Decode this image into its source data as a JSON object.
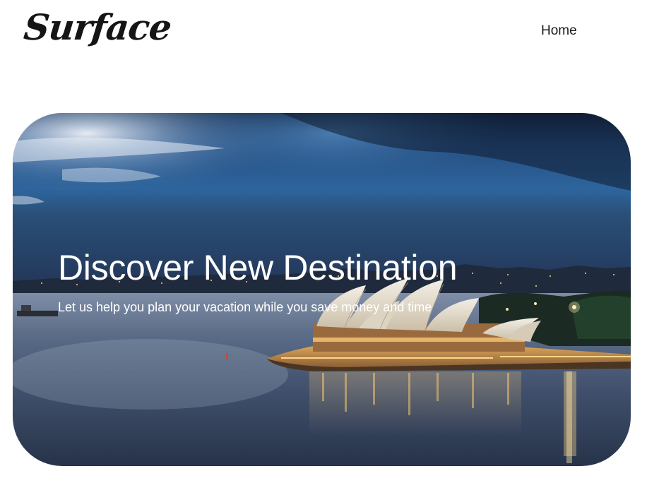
{
  "header": {
    "logo_text": "Surface",
    "nav": [
      {
        "label": "Home"
      }
    ]
  },
  "hero": {
    "title": "Discover New Destination",
    "subtitle": "Let us help you plan your vacation while you save money and time"
  },
  "colors": {
    "sky_top": "#1b2c49",
    "sky_blue": "#2f6aa3",
    "water": "#4a5f7c",
    "city_lights": "#f3b55a",
    "text": "#ffffff"
  }
}
